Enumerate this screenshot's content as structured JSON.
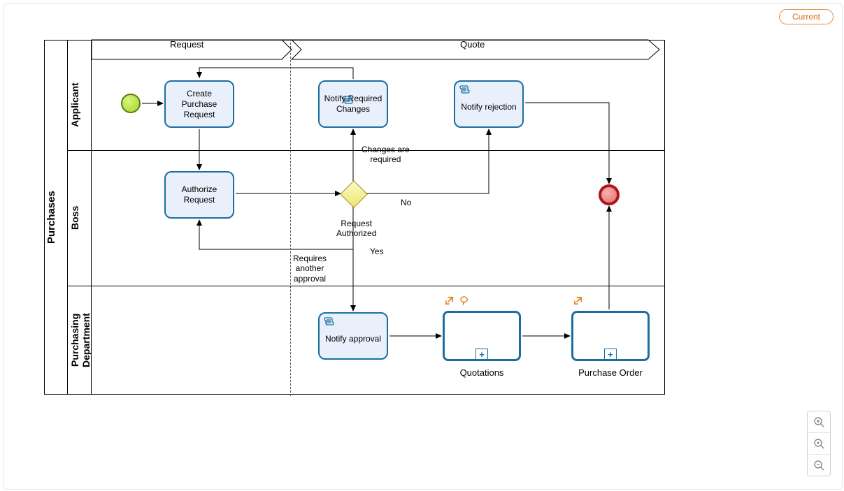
{
  "button_current": "Current",
  "pool": "Purchases",
  "lanes": {
    "applicant": "Applicant",
    "boss": "Boss",
    "purchasing": "Purchasing\nDepartment"
  },
  "phases": {
    "request": "Request",
    "quote": "Quote"
  },
  "tasks": {
    "create": "Create\nPurchase\nRequest",
    "notify_changes": "Notify Required\nChanges",
    "notify_rejection": "Notify rejection",
    "authorize": "Authorize\nRequest",
    "notify_approval": "Notify approval"
  },
  "subprocesses": {
    "quotations": "Quotations",
    "purchase_order": "Purchase Order"
  },
  "edge_labels": {
    "changes_required": "Changes are\nrequired",
    "no": "No",
    "request_authorized": "Request\nAuthorized",
    "yes": "Yes",
    "requires_another": "Requires\nanother\napproval"
  },
  "zoom": {
    "in": "zoom-in",
    "reset": "zoom-reset",
    "out": "zoom-out"
  }
}
